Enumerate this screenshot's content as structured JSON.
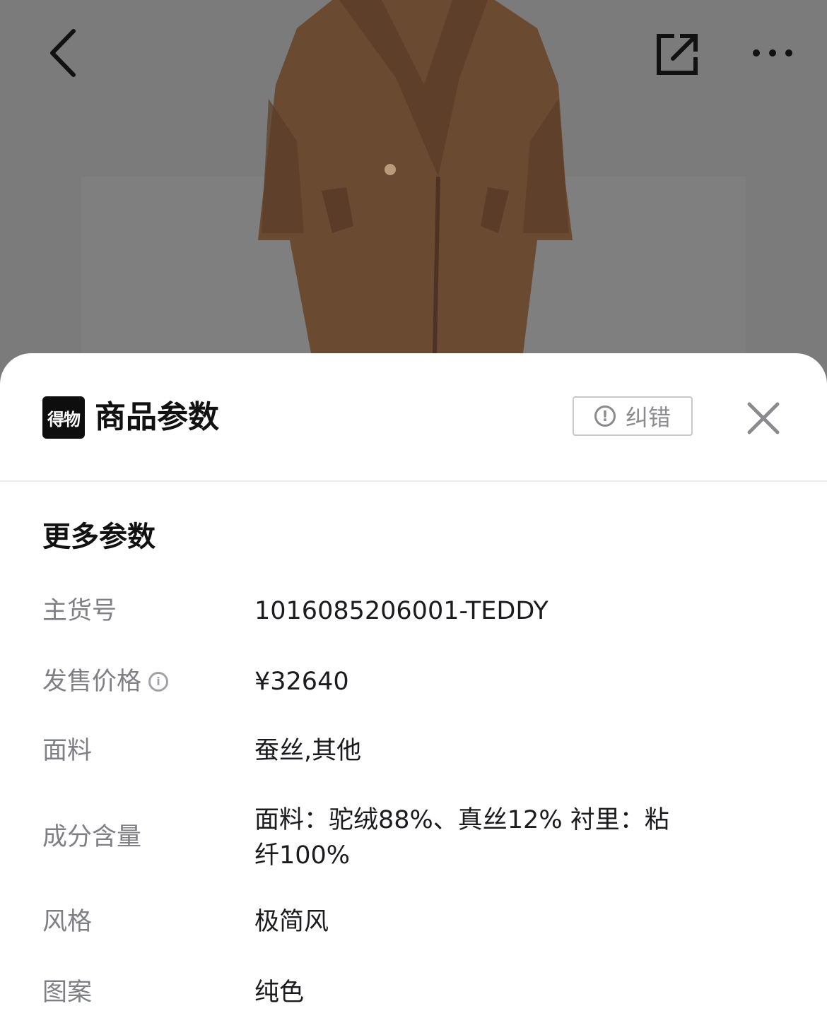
{
  "nav": {
    "back_icon": "chevron-left-icon",
    "share_icon": "share-external-icon",
    "more_icon": "more-horizontal-icon"
  },
  "sheet": {
    "logo_text": "得物",
    "title": "商品参数",
    "report_label": "纠错",
    "report_icon": "exclamation-circle-icon",
    "close_icon": "close-icon"
  },
  "section": {
    "title": "更多参数"
  },
  "params": [
    {
      "label": "主货号",
      "value": "1016085206001-TEDDY"
    },
    {
      "label": "发售价格",
      "value": "¥32640",
      "has_info": true
    },
    {
      "label": "面料",
      "value": "蚕丝,其他"
    },
    {
      "label": "成分含量",
      "value_line1": "面料：驼绒88%、真丝12% 衬里：粘",
      "value_line2": "纤100%"
    },
    {
      "label": "风格",
      "value": "极简风"
    },
    {
      "label": "图案",
      "value": "纯色"
    }
  ],
  "colors": {
    "overlay": "#7a7a7a",
    "coat": "#6b4a32",
    "label": "#7f7f86",
    "text": "#1b1b1f"
  }
}
